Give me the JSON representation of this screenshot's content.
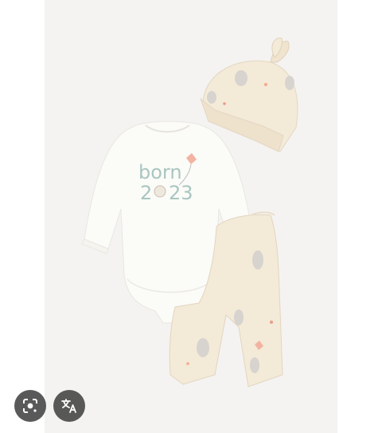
{
  "image": {
    "print": {
      "word": "born",
      "year_left": "2",
      "year_right": "23"
    }
  },
  "overlay": {
    "lens_icon": "lens-icon",
    "translate_icon": "translate-icon"
  },
  "colors": {
    "background": "#f4f3f1",
    "bodysuit": "#fbfbf8",
    "cream_fabric": "#f4ead8",
    "print_accent": "#a9c6c0",
    "overlay_button": "#3c3c3c"
  }
}
